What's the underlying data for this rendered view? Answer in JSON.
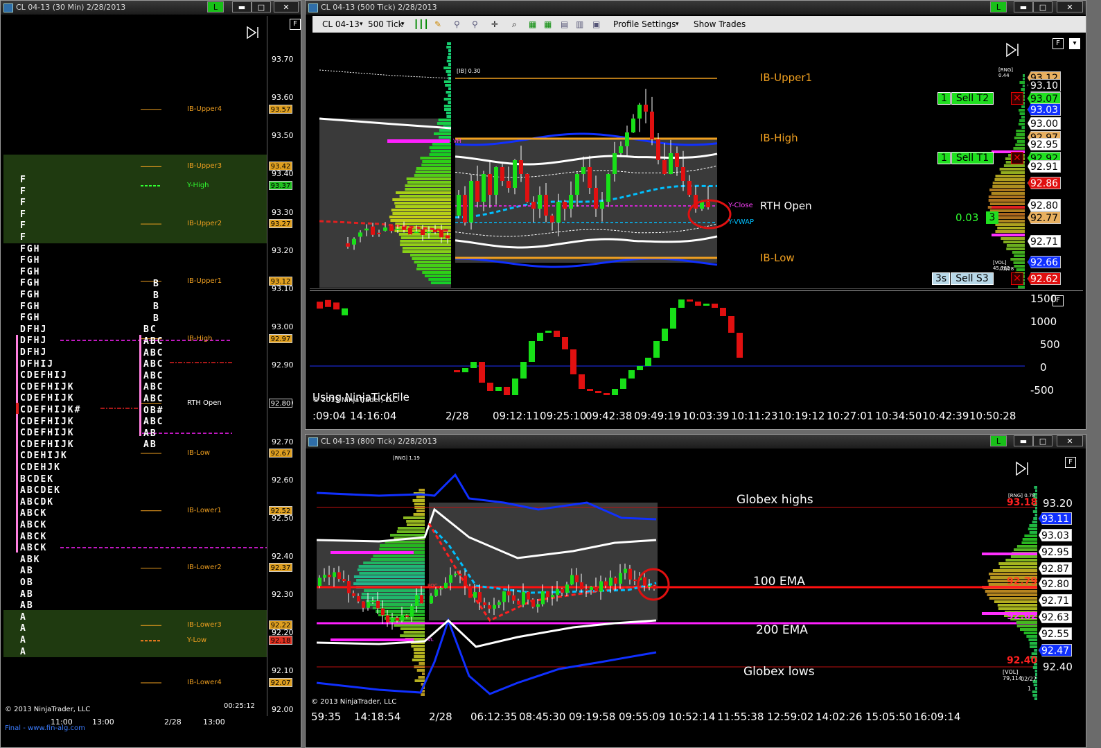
{
  "left_window": {
    "title": "CL 04-13 (30 Min)  2/28/2013",
    "btn_l": "L",
    "btn_min": "▬",
    "btn_max": "□",
    "btn_close": "✕",
    "f_label": "F",
    "price_ticks": [
      "93.70",
      "93.60",
      "93.50",
      "93.40",
      "93.30",
      "93.20",
      "93.10",
      "93.00",
      "92.90",
      "92.80",
      "92.70",
      "92.60",
      "92.50",
      "92.40",
      "92.30",
      "92.20",
      "92.10",
      "92.00"
    ],
    "levels": [
      {
        "name": "IB-Upper4",
        "price": "93.57"
      },
      {
        "name": "IB-Upper3",
        "price": "93.42"
      },
      {
        "name": "Y-High",
        "price": "93.37"
      },
      {
        "name": "IB-Upper2",
        "price": "93.27"
      },
      {
        "name": "IB-Upper1",
        "price": "93.12"
      },
      {
        "name": "IB-High",
        "price": "92.97"
      },
      {
        "name": "RTH Open",
        "price": "92.80"
      },
      {
        "name": "IB-Low",
        "price": "92.67"
      },
      {
        "name": "IB-Lower1",
        "price": "92.52"
      },
      {
        "name": "IB-Lower2",
        "price": "92.37"
      },
      {
        "name": "IB-Lower3",
        "price": "92.22"
      },
      {
        "name": "Y-Low",
        "price": "92.18"
      },
      {
        "name": "IB-Lower4",
        "price": "92.07"
      }
    ],
    "profile_rows_left": [
      "F",
      "F",
      "F",
      "F",
      "F",
      "F",
      "FGH",
      "FGH",
      "FGH",
      "FGH",
      "FGH",
      "FGH",
      "FGH",
      "DFHJ",
      "DFHJ",
      "DFHJ",
      "DFHIJ",
      "CDEFHIJ",
      "CDEFHIJK",
      "CDEFHIJK",
      "CDEFHIJK#",
      "CDEFHIJK",
      "CDEFHIJK",
      "CDEFHIJK",
      "CDEHIJK",
      "CDEHJK",
      "BCDEK",
      "ABCDEK",
      "ABCDK",
      "ABCK",
      "ABCK",
      "ABCK",
      "ABCK",
      "ABK",
      "AB",
      "OB",
      "AB",
      "AB",
      "A",
      "A",
      "A",
      "A"
    ],
    "profile_rows_right": [
      "B",
      "B",
      "B",
      "B",
      "BC",
      "ABC",
      "ABC",
      "ABC",
      "ABC",
      "ABC",
      "ABC",
      "OB#",
      "ABC",
      "AB",
      "AB"
    ],
    "copyright": "© 2013 NinjaTrader, LLC",
    "clock": "00:25:12",
    "time_labels": [
      "11:00",
      "13:00",
      "2/28",
      "13:00"
    ],
    "footer": "Final - www.fin-alg.com"
  },
  "top_window": {
    "title": "CL 04-13 (500 Tick)  2/28/2013",
    "toolbar": {
      "instrument": "CL 04-13",
      "period": "500 Tick",
      "profile_settings": "Profile Settings",
      "show_trades": "Show Trades"
    },
    "price_pane": {
      "ib_label": "[IB] 0.30",
      "rng_label": "[RNG] 0.44",
      "vol_label": "[VOL] 45,782",
      "date_small": "02/28 ",
      "vh_label": "VH",
      "yclose_label": "Y-Close",
      "yvwap_label": "Y-VWAP",
      "text_labels": [
        "IB-Upper1",
        "IB-High",
        "RTH Open",
        "IB-Low"
      ],
      "price_boxes": [
        {
          "price": "93.12",
          "style": "tan"
        },
        {
          "price": "93.10",
          "style": "plain"
        },
        {
          "price": "93.07",
          "style": "green"
        },
        {
          "price": "93.03",
          "style": "blue"
        },
        {
          "price": "93.00",
          "style": "white"
        },
        {
          "price": "92.97",
          "style": "tan"
        },
        {
          "price": "92.95",
          "style": "white"
        },
        {
          "price": "92.92",
          "style": "green"
        },
        {
          "price": "92.91",
          "style": "white"
        },
        {
          "price": "92.86",
          "style": "red"
        },
        {
          "price": "92.80",
          "style": "white"
        },
        {
          "price": "92.77",
          "style": "tan"
        },
        {
          "price": "92.71",
          "style": "white"
        },
        {
          "price": "92.66",
          "style": "blue"
        },
        {
          "price": "92.62",
          "style": "red"
        }
      ],
      "orders": [
        {
          "qty": "1",
          "label": "Sell T2"
        },
        {
          "qty": "1",
          "label": "Sell T1"
        },
        {
          "qty": "3s",
          "label": "Sell S3"
        }
      ],
      "pnl_value": "0.03",
      "pnl_qty": "3"
    },
    "osc_pane": {
      "ticks": [
        "1500",
        "1000",
        "500",
        "0",
        "-500"
      ],
      "note": "Using NinjaTickFile",
      "copyright": "© 2013 NinjaTrader, LLC"
    },
    "time_labels": [
      ":09:04",
      "14:16:04",
      "2/28",
      "09:12:11",
      "09:25:10",
      "09:42:38",
      "09:49:19",
      "10:03:39",
      "10:11:23",
      "10:19:12",
      "10:27:01",
      "10:34:50",
      "10:42:39",
      "10:50:28"
    ]
  },
  "bottom_window": {
    "title": "CL 04-13 (800 Tick)  2/28/2013",
    "rng_label": "[RNG] 0.78",
    "rng_top": "[RNG] 1.19",
    "vol_label": "[VOL] 79,114",
    "vol_date": "02/27",
    "vol_num": "1",
    "vl_label": "VL",
    "poc_label": "POC",
    "text_labels": [
      "Globex highs",
      "100 EMA",
      "200 EMA",
      "Globex lows"
    ],
    "price_ticks": [
      "93.20",
      "92.40"
    ],
    "red_prices": [
      "93.18",
      "92.79",
      "92.40"
    ],
    "magenta_price": "92.62",
    "price_boxes": [
      {
        "price": "93.11",
        "style": "blue"
      },
      {
        "price": "93.03",
        "style": "white"
      },
      {
        "price": "92.95",
        "style": "white"
      },
      {
        "price": "92.87",
        "style": "white"
      },
      {
        "price": "92.80",
        "style": "white"
      },
      {
        "price": "92.71",
        "style": "white"
      },
      {
        "price": "92.63",
        "style": "white"
      },
      {
        "price": "92.55",
        "style": "white"
      },
      {
        "price": "92.47",
        "style": "blue"
      }
    ],
    "copyright": "© 2013 NinjaTrader, LLC",
    "time_labels": [
      "59:35",
      "14:18:54",
      "2/28",
      "06:12:35",
      "08:45:30",
      "09:19:58",
      "09:55:09",
      "10:52:14",
      "11:55:38",
      "12:59:02",
      "14:02:26",
      "15:05:50",
      "16:09:14"
    ]
  },
  "colors": {
    "ib": "#f0a020",
    "vwap": "#00c0ff",
    "magenta": "#ff20ff",
    "band_blue": "#1030ff",
    "up": "#18e018",
    "down": "#e01010",
    "profile_zone": "#1f3a10"
  }
}
